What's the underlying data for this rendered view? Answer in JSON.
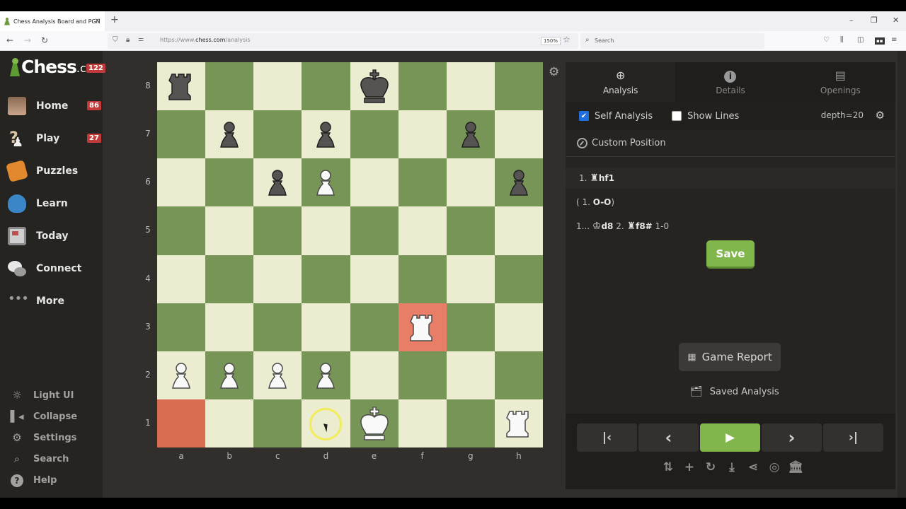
{
  "browser": {
    "tab_title": "Chess Analysis Board and PGN",
    "tab_close": "×",
    "new_tab": "+",
    "window_controls": [
      "–",
      "❐",
      "✕"
    ],
    "url_prefix": "https://www.",
    "url_domain": "chess.com",
    "url_path": "/analysis",
    "zoom": "150%",
    "search_placeholder": "Search",
    "nav": {
      "back": "←",
      "forward": "→",
      "reload": "↻"
    }
  },
  "sidebar": {
    "logo_main": "Chess",
    "logo_suffix": ".com",
    "logo_badge": "122",
    "items": [
      {
        "label": "Home",
        "icon": "avatar-icon",
        "badge": "86"
      },
      {
        "label": "Play",
        "icon": "play-pawn-icon",
        "badge": "27"
      },
      {
        "label": "Puzzles",
        "icon": "puzzle-icon",
        "badge": null
      },
      {
        "label": "Learn",
        "icon": "graduation-cap-icon",
        "badge": null
      },
      {
        "label": "Today",
        "icon": "newspaper-icon",
        "badge": null
      },
      {
        "label": "Connect",
        "icon": "chat-bubbles-icon",
        "badge": null
      },
      {
        "label": "More",
        "icon": "more-dots-icon",
        "badge": null
      }
    ],
    "bottom_items": [
      {
        "label": "Light UI",
        "icon": "sun-icon",
        "glyph": "☼"
      },
      {
        "label": "Collapse",
        "icon": "collapse-icon",
        "glyph": "◂"
      },
      {
        "label": "Settings",
        "icon": "gear-icon",
        "glyph": "⚙"
      },
      {
        "label": "Search",
        "icon": "search-icon",
        "glyph": "⌕"
      },
      {
        "label": "Help",
        "icon": "help-icon",
        "glyph": "?"
      }
    ]
  },
  "board": {
    "ranks": [
      "8",
      "7",
      "6",
      "5",
      "4",
      "3",
      "2",
      "1"
    ],
    "files": [
      "a",
      "b",
      "c",
      "d",
      "e",
      "f",
      "g",
      "h"
    ],
    "highlighted_squares": [
      "a1",
      "f3"
    ],
    "pieces": {
      "a8": "bR",
      "e8": "bK",
      "b7": "bP",
      "d7": "bP",
      "g7": "bP",
      "c6": "bP",
      "d6": "wP",
      "h6": "bP",
      "f3": "wR",
      "a2": "wP",
      "b2": "wP",
      "c2": "wP",
      "d2": "wP",
      "e1": "wK",
      "h1": "wR"
    },
    "colors": {
      "light": "#ebecd0",
      "dark": "#779556",
      "highlight": "#e87e67"
    }
  },
  "panel": {
    "tabs": [
      {
        "label": "Analysis",
        "icon": "analysis-icon",
        "glyph": "🔍",
        "active": true
      },
      {
        "label": "Details",
        "icon": "info-icon",
        "glyph": "ℹ",
        "active": false
      },
      {
        "label": "Openings",
        "icon": "book-stack-icon",
        "glyph": "📚",
        "active": false
      }
    ],
    "self_analysis_label": "Self Analysis",
    "self_analysis_checked": true,
    "show_lines_label": "Show Lines",
    "show_lines_checked": false,
    "depth": "depth=20",
    "custom_position": "Custom Position",
    "moves": [
      {
        "prefix": "1.",
        "piece": "♜",
        "move": "hf1",
        "suffix": ""
      },
      {
        "prefix": "( 1.",
        "piece": "",
        "move": "O-O",
        "suffix": ")"
      },
      {
        "prefix": "1...",
        "piece": "♔",
        "move": "d8",
        "prefix2": "2.",
        "piece2": "♜",
        "move2": "f8#",
        "result": "1-0"
      }
    ],
    "save_label": "Save",
    "game_report_label": "Game Report",
    "saved_analysis_label": "Saved Analysis",
    "controls": {
      "first": "|‹",
      "prev": "‹",
      "play": "▶",
      "next": "›",
      "last": "›|"
    },
    "tools": [
      {
        "name": "flip-board-icon",
        "glyph": "⇅"
      },
      {
        "name": "add-icon",
        "glyph": "+"
      },
      {
        "name": "reset-icon",
        "glyph": "↻"
      },
      {
        "name": "download-icon",
        "glyph": "⤓"
      },
      {
        "name": "share-icon",
        "glyph": "⋖"
      },
      {
        "name": "target-icon",
        "glyph": "◎"
      },
      {
        "name": "library-icon",
        "glyph": "🏛"
      }
    ]
  }
}
